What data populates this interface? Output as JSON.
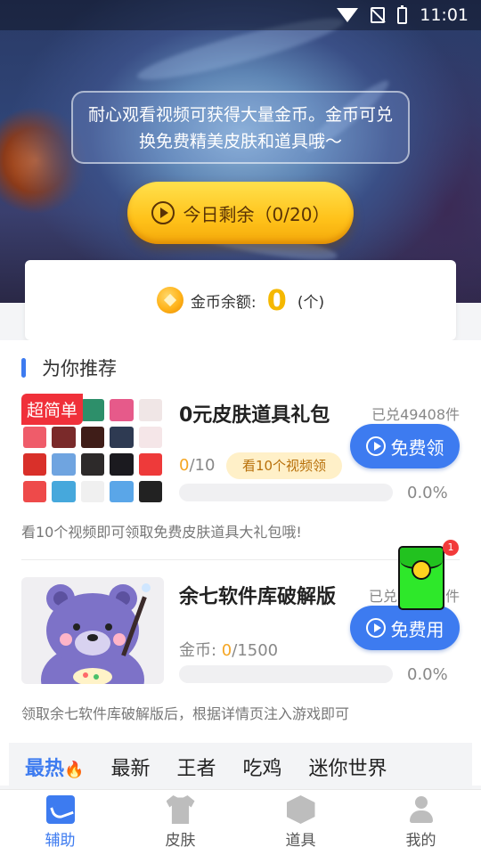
{
  "status_bar": {
    "time": "11:01"
  },
  "hero": {
    "notice": "耐心观看视频可获得大量金币。金币可兑换免费精美皮肤和道具哦～",
    "today_button": {
      "label": "今日剩余",
      "count": "（0/20）"
    }
  },
  "balance": {
    "label": "金币余额:",
    "value": "0",
    "unit": "(个)"
  },
  "section": {
    "title": "为你推荐"
  },
  "items": [
    {
      "badge": "超简单",
      "title": "0元皮肤道具礼包",
      "redeemed": "已兑49408件",
      "progress_current": "0",
      "progress_total": "/10",
      "watch_tag": "看10个视频领",
      "percent": "0.0%",
      "button": "免费领",
      "description": "看10个视频即可领取免费皮肤道具大礼包哦!"
    },
    {
      "title": "余七软件库破解版",
      "redeemed": "已兑",
      "redeemed_tail": "件",
      "price_label": "金币: ",
      "progress_current": "0",
      "progress_total": "/1500",
      "percent": "0.0%",
      "button": "免费用",
      "description": "领取余七软件库破解版后，根据详情页注入游戏即可"
    }
  ],
  "floating_packet": {
    "badge": "1"
  },
  "category_tabs": [
    "最热",
    "最新",
    "王者",
    "吃鸡",
    "迷你世界"
  ],
  "active_tab": "最热",
  "bottom_nav": [
    {
      "label": "辅助",
      "icon": "assist-icon",
      "active": true
    },
    {
      "label": "皮肤",
      "icon": "shirt-icon",
      "active": false
    },
    {
      "label": "道具",
      "icon": "box-icon",
      "active": false
    },
    {
      "label": "我的",
      "icon": "user-icon",
      "active": false
    }
  ],
  "colors": {
    "accent": "#3d7bf0",
    "gold": "#f5b800",
    "badge_red": "#f0303a"
  }
}
